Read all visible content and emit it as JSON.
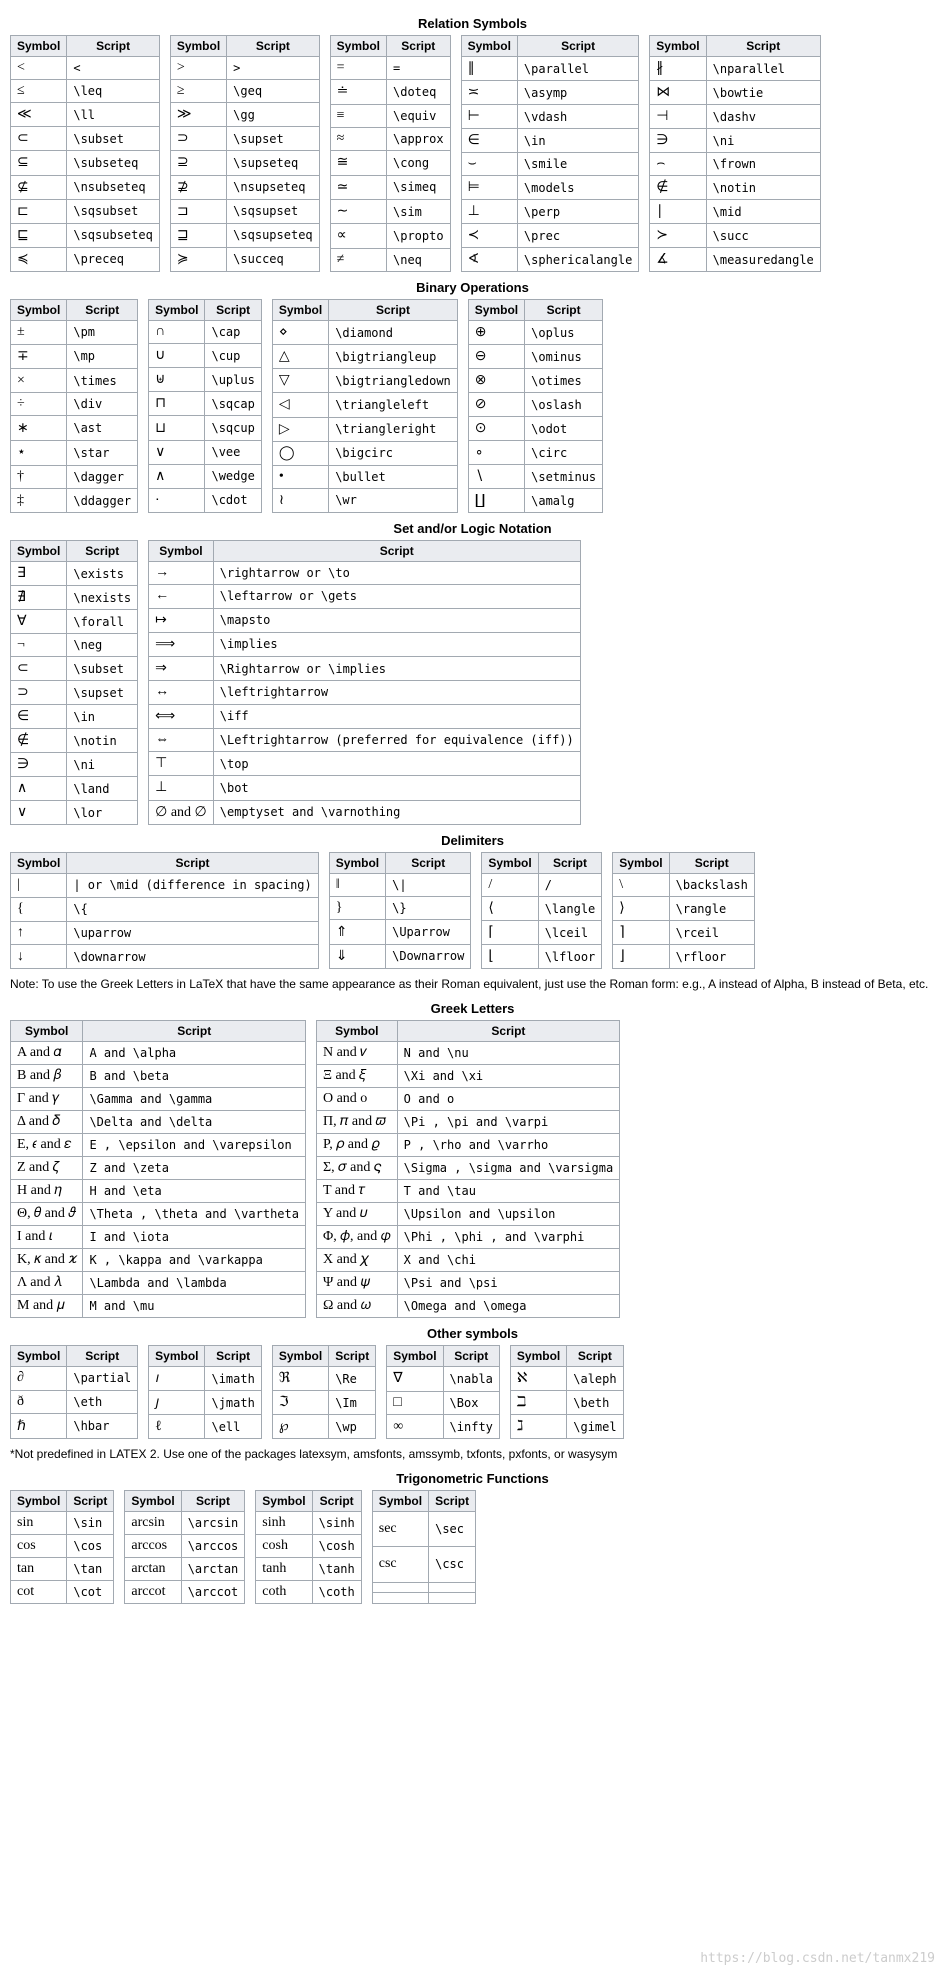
{
  "sections": [
    {
      "title": "Relation Symbols",
      "tables": [
        {
          "rows": [
            [
              "<",
              "<"
            ],
            [
              "≤",
              "\\leq"
            ],
            [
              "≪",
              "\\ll"
            ],
            [
              "⊂",
              "\\subset"
            ],
            [
              "⊆",
              "\\subseteq"
            ],
            [
              "⊈",
              "\\nsubseteq"
            ],
            [
              "⊏",
              "\\sqsubset"
            ],
            [
              "⊑",
              "\\sqsubseteq"
            ],
            [
              "≼",
              "\\preceq"
            ]
          ]
        },
        {
          "rows": [
            [
              ">",
              ">"
            ],
            [
              "≥",
              "\\geq"
            ],
            [
              "≫",
              "\\gg"
            ],
            [
              "⊃",
              "\\supset"
            ],
            [
              "⊇",
              "\\supseteq"
            ],
            [
              "⊉",
              "\\nsupseteq"
            ],
            [
              "⊐",
              "\\sqsupset"
            ],
            [
              "⊒",
              "\\sqsupseteq"
            ],
            [
              "≽",
              "\\succeq"
            ]
          ]
        },
        {
          "rows": [
            [
              "=",
              "="
            ],
            [
              "≐",
              "\\doteq"
            ],
            [
              "≡",
              "\\equiv"
            ],
            [
              "≈",
              "\\approx"
            ],
            [
              "≅",
              "\\cong"
            ],
            [
              "≃",
              "\\simeq"
            ],
            [
              "∼",
              "\\sim"
            ],
            [
              "∝",
              "\\propto"
            ],
            [
              "≠",
              "\\neq"
            ]
          ]
        },
        {
          "rows": [
            [
              "∥",
              "\\parallel"
            ],
            [
              "≍",
              "\\asymp"
            ],
            [
              "⊢",
              "\\vdash"
            ],
            [
              "∈",
              "\\in"
            ],
            [
              "⌣",
              "\\smile"
            ],
            [
              "⊨",
              "\\models"
            ],
            [
              "⊥",
              "\\perp"
            ],
            [
              "≺",
              "\\prec"
            ],
            [
              "∢",
              "\\sphericalangle"
            ]
          ]
        },
        {
          "rows": [
            [
              "∦",
              "\\nparallel"
            ],
            [
              "⋈",
              "\\bowtie"
            ],
            [
              "⊣",
              "\\dashv"
            ],
            [
              "∋",
              "\\ni"
            ],
            [
              "⌢",
              "\\frown"
            ],
            [
              "∉",
              "\\notin"
            ],
            [
              "∣",
              "\\mid"
            ],
            [
              "≻",
              "\\succ"
            ],
            [
              "∡",
              "\\measuredangle"
            ]
          ]
        }
      ]
    },
    {
      "title": "Binary Operations",
      "tables": [
        {
          "rows": [
            [
              "±",
              "\\pm"
            ],
            [
              "∓",
              "\\mp"
            ],
            [
              "×",
              "\\times"
            ],
            [
              "÷",
              "\\div"
            ],
            [
              "∗",
              "\\ast"
            ],
            [
              "⋆",
              "\\star"
            ],
            [
              "†",
              "\\dagger"
            ],
            [
              "‡",
              "\\ddagger"
            ]
          ]
        },
        {
          "rows": [
            [
              "∩",
              "\\cap"
            ],
            [
              "∪",
              "\\cup"
            ],
            [
              "⊎",
              "\\uplus"
            ],
            [
              "⊓",
              "\\sqcap"
            ],
            [
              "⊔",
              "\\sqcup"
            ],
            [
              "∨",
              "\\vee"
            ],
            [
              "∧",
              "\\wedge"
            ],
            [
              "⋅",
              "\\cdot"
            ]
          ]
        },
        {
          "rows": [
            [
              "⋄",
              "\\diamond"
            ],
            [
              "△",
              "\\bigtriangleup"
            ],
            [
              "▽",
              "\\bigtriangledown"
            ],
            [
              "◁",
              "\\triangleleft"
            ],
            [
              "▷",
              "\\triangleright"
            ],
            [
              "◯",
              "\\bigcirc"
            ],
            [
              "•",
              "\\bullet"
            ],
            [
              "≀",
              "\\wr"
            ]
          ]
        },
        {
          "rows": [
            [
              "⊕",
              "\\oplus"
            ],
            [
              "⊖",
              "\\ominus"
            ],
            [
              "⊗",
              "\\otimes"
            ],
            [
              "⊘",
              "\\oslash"
            ],
            [
              "⊙",
              "\\odot"
            ],
            [
              "∘",
              "\\circ"
            ],
            [
              "∖",
              "\\setminus"
            ],
            [
              "∐",
              "\\amalg"
            ]
          ]
        }
      ]
    },
    {
      "title": "Set and/or Logic Notation",
      "tables": [
        {
          "rows": [
            [
              "∃",
              "\\exists"
            ],
            [
              "∄",
              "\\nexists"
            ],
            [
              "∀",
              "\\forall"
            ],
            [
              "¬",
              "\\neg"
            ],
            [
              "⊂",
              "\\subset"
            ],
            [
              "⊃",
              "\\supset"
            ],
            [
              "∈",
              "\\in"
            ],
            [
              "∉",
              "\\notin"
            ],
            [
              "∋",
              "\\ni"
            ],
            [
              "∧",
              "\\land"
            ],
            [
              "∨",
              "\\lor"
            ]
          ]
        },
        {
          "rows": [
            [
              "→",
              "\\rightarrow  or  \\to"
            ],
            [
              "←",
              "\\leftarrow  or  \\gets"
            ],
            [
              "↦",
              "\\mapsto"
            ],
            [
              "⟹",
              "\\implies"
            ],
            [
              "⇒",
              "\\Rightarrow  or  \\implies"
            ],
            [
              "↔",
              "\\leftrightarrow"
            ],
            [
              "⟺",
              "\\iff"
            ],
            [
              "⇔",
              "\\Leftrightarrow   (preferred for equivalence (iff))"
            ],
            [
              "⊤",
              "\\top"
            ],
            [
              "⊥",
              "\\bot"
            ],
            [
              "∅ and ∅",
              "\\emptyset  and  \\varnothing"
            ]
          ]
        }
      ]
    },
    {
      "title": "Delimiters",
      "tables": [
        {
          "rows": [
            [
              "|",
              "|  or  \\mid   (difference in spacing)"
            ],
            [
              "{",
              "\\{"
            ],
            [
              "↑",
              "\\uparrow"
            ],
            [
              "↓",
              "\\downarrow"
            ]
          ]
        },
        {
          "rows": [
            [
              "‖",
              "\\|"
            ],
            [
              "}",
              "\\}"
            ],
            [
              "⇑",
              "\\Uparrow"
            ],
            [
              "⇓",
              "\\Downarrow"
            ]
          ]
        },
        {
          "rows": [
            [
              "/",
              "/"
            ],
            [
              "⟨",
              "\\langle"
            ],
            [
              "⌈",
              "\\lceil"
            ],
            [
              "⌊",
              "\\lfloor"
            ]
          ]
        },
        {
          "rows": [
            [
              "\\",
              "\\backslash"
            ],
            [
              "⟩",
              "\\rangle"
            ],
            [
              "⌉",
              "\\rceil"
            ],
            [
              "⌋",
              "\\rfloor"
            ]
          ]
        }
      ]
    },
    {
      "title": "Greek Letters",
      "note_before": "Note: To use the Greek Letters in LaTeX that have the same appearance as their Roman equivalent, just use the Roman form: e.g., A instead of Alpha, B instead of Beta, etc.",
      "tables": [
        {
          "rows": [
            [
              "A and 𝛼",
              "A  and  \\alpha"
            ],
            [
              "B and 𝛽",
              "B  and  \\beta"
            ],
            [
              "Γ and 𝛾",
              "\\Gamma  and  \\gamma"
            ],
            [
              "Δ and 𝛿",
              "\\Delta  and  \\delta"
            ],
            [
              "E, 𝜖 and 𝜀",
              "E ,  \\epsilon  and  \\varepsilon"
            ],
            [
              "Z and 𝜁",
              "Z  and  \\zeta"
            ],
            [
              "H and 𝜂",
              "H  and  \\eta"
            ],
            [
              "Θ, 𝜃 and 𝜗",
              "\\Theta ,  \\theta  and  \\vartheta"
            ],
            [
              "I and 𝜄",
              "I  and  \\iota"
            ],
            [
              "K, 𝜅 and 𝜘",
              "K ,  \\kappa  and  \\varkappa"
            ],
            [
              "Λ and 𝜆",
              "\\Lambda  and  \\lambda"
            ],
            [
              "M and 𝜇",
              "M  and  \\mu"
            ]
          ]
        },
        {
          "rows": [
            [
              "N and 𝜈",
              "N  and  \\nu"
            ],
            [
              "Ξ and 𝜉",
              "\\Xi  and  \\xi"
            ],
            [
              "O and o",
              "O  and  o"
            ],
            [
              "Π, 𝜋 and 𝜛",
              "\\Pi ,  \\pi  and  \\varpi"
            ],
            [
              "P, 𝜌 and 𝜚",
              "P ,  \\rho  and  \\varrho"
            ],
            [
              "Σ, 𝜎 and 𝜍",
              "\\Sigma ,  \\sigma  and  \\varsigma"
            ],
            [
              "T and 𝜏",
              "T  and  \\tau"
            ],
            [
              "Υ and 𝜐",
              "\\Upsilon  and  \\upsilon"
            ],
            [
              "Φ, 𝜙, and 𝜑",
              "\\Phi ,  \\phi ,  and  \\varphi"
            ],
            [
              "X and 𝜒",
              "X  and  \\chi"
            ],
            [
              "Ψ and 𝜓",
              "\\Psi  and  \\psi"
            ],
            [
              "Ω and 𝜔",
              "\\Omega  and  \\omega"
            ]
          ]
        }
      ]
    },
    {
      "title": "Other symbols",
      "tables": [
        {
          "rows": [
            [
              "∂",
              "\\partial"
            ],
            [
              "ð",
              "\\eth"
            ],
            [
              "ℏ",
              "\\hbar"
            ]
          ]
        },
        {
          "rows": [
            [
              "𝚤",
              "\\imath"
            ],
            [
              "𝚥",
              "\\jmath"
            ],
            [
              "ℓ",
              "\\ell"
            ]
          ]
        },
        {
          "rows": [
            [
              "ℜ",
              "\\Re"
            ],
            [
              "ℑ",
              "\\Im"
            ],
            [
              "℘",
              "\\wp"
            ]
          ]
        },
        {
          "rows": [
            [
              "∇",
              "\\nabla"
            ],
            [
              "□",
              "\\Box"
            ],
            [
              "∞",
              "\\infty"
            ]
          ]
        },
        {
          "rows": [
            [
              "ℵ",
              "\\aleph"
            ],
            [
              "ℶ",
              "\\beth"
            ],
            [
              "ℷ",
              "\\gimel"
            ]
          ]
        }
      ],
      "note_after": "*Not predefined in LATEX 2. Use one of the packages latexsym, amsfonts, amssymb, txfonts, pxfonts, or wasysym"
    },
    {
      "title": "Trigonometric Functions",
      "tables": [
        {
          "rows": [
            [
              "sin",
              "\\sin"
            ],
            [
              "cos",
              "\\cos"
            ],
            [
              "tan",
              "\\tan"
            ],
            [
              "cot",
              "\\cot"
            ]
          ]
        },
        {
          "rows": [
            [
              "arcsin",
              "\\arcsin"
            ],
            [
              "arccos",
              "\\arccos"
            ],
            [
              "arctan",
              "\\arctan"
            ],
            [
              "arccot",
              "\\arccot"
            ]
          ]
        },
        {
          "rows": [
            [
              "sinh",
              "\\sinh"
            ],
            [
              "cosh",
              "\\cosh"
            ],
            [
              "tanh",
              "\\tanh"
            ],
            [
              "coth",
              "\\coth"
            ]
          ]
        },
        {
          "rows": [
            [
              "sec",
              "\\sec"
            ],
            [
              "csc",
              "\\csc"
            ],
            [
              "",
              ""
            ],
            [
              "",
              ""
            ]
          ]
        }
      ]
    }
  ],
  "headers": {
    "symbol": "Symbol",
    "script": "Script"
  },
  "watermark": "https://blog.csdn.net/tanmx219"
}
